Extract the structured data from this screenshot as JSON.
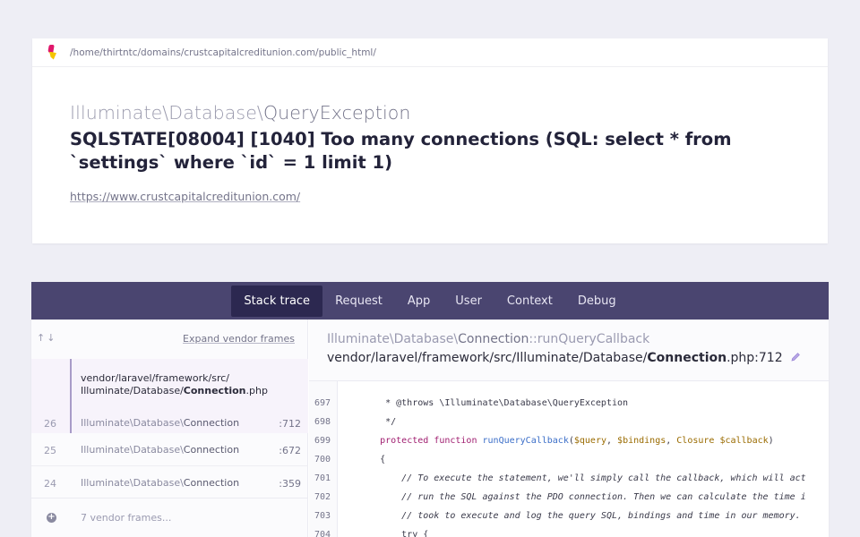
{
  "header": {
    "path": "/home/thirtntc/domains/crustcapitalcreditunion.com/public_html/"
  },
  "exception": {
    "class_prefix": "Illuminate\\Database\\",
    "class_name": "QueryException",
    "message": "SQLSTATE[08004] [1040] Too many connections (SQL: select * from `settings` where `id` = 1 limit 1)",
    "url": "https://www.crustcapitalcreditunion.com/"
  },
  "tabs": [
    {
      "label": "Stack trace"
    },
    {
      "label": "Request"
    },
    {
      "label": "App"
    },
    {
      "label": "User"
    },
    {
      "label": "Context"
    },
    {
      "label": "Debug"
    }
  ],
  "trace": {
    "arrows": "↑↓",
    "expand_label": "Expand vendor frames",
    "selected_file_dir": "vendor/laravel/framework/src/",
    "selected_file_path": "Illuminate/Database/",
    "selected_file_name": "Connection",
    "selected_file_ext": ".php",
    "frames": [
      {
        "num": "26",
        "prefix": "Illuminate\\Database\\",
        "cls": "Connection",
        "line": ":712"
      },
      {
        "num": "25",
        "prefix": "Illuminate\\Database\\",
        "cls": "Connection",
        "line": ":672"
      },
      {
        "num": "24",
        "prefix": "Illuminate\\Database\\",
        "cls": "Connection",
        "line": ":359"
      }
    ],
    "vendor_frames": "7 vendor frames..."
  },
  "detail": {
    "class_prefix": "Illuminate\\Database\\",
    "class_name": "Connection",
    "method": "::runQueryCallback",
    "file_dir": "vendor/laravel/framework/src/Illuminate/Database/",
    "file_name": "Connection",
    "file_ext": ".php:712"
  },
  "code": [
    {
      "n": "697",
      "text": "     * @throws \\Illuminate\\Database\\QueryException"
    },
    {
      "n": "698",
      "text": "     */"
    },
    {
      "n": "699",
      "text": ""
    },
    {
      "n": "700",
      "text": "    {"
    },
    {
      "n": "701",
      "text": "        // To execute the statement, we'll simply call the callback, which will act"
    },
    {
      "n": "702",
      "text": "        // run the SQL against the PDO connection. Then we can calculate the time i"
    },
    {
      "n": "703",
      "text": "        // took to execute and log the query SQL, bindings and time in our memory."
    },
    {
      "n": "704",
      "text": "        try {"
    }
  ],
  "code_699": {
    "kw1": "protected",
    "kw2": "function",
    "fn": "runQueryCallback",
    "open": "(",
    "v1": "$query",
    "sep1": ", ",
    "v2": "$bindings",
    "sep2": ", ",
    "v3": "Closure $callback",
    "close": ")"
  },
  "colors": {
    "tabs_bg": "#4a4570",
    "tab_active": "#2c2850",
    "selected_frame_bg": "#f7f3fb"
  }
}
